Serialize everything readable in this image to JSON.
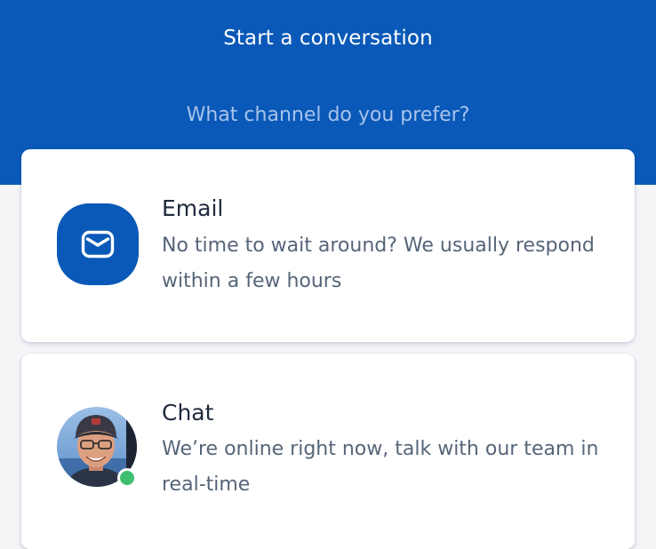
{
  "header": {
    "title": "Start a conversation",
    "subtitle": "What channel do you prefer?",
    "background": "#0a59b8"
  },
  "channels": [
    {
      "title": "Email",
      "description": "No time to wait around? We usually respond within a few hours",
      "icon": "envelope-icon"
    },
    {
      "title": "Chat",
      "description": "We’re online right now, talk with our team in real-time",
      "icon": "agent-avatar",
      "status": "online",
      "status_color": "#3dbf6f"
    }
  ]
}
